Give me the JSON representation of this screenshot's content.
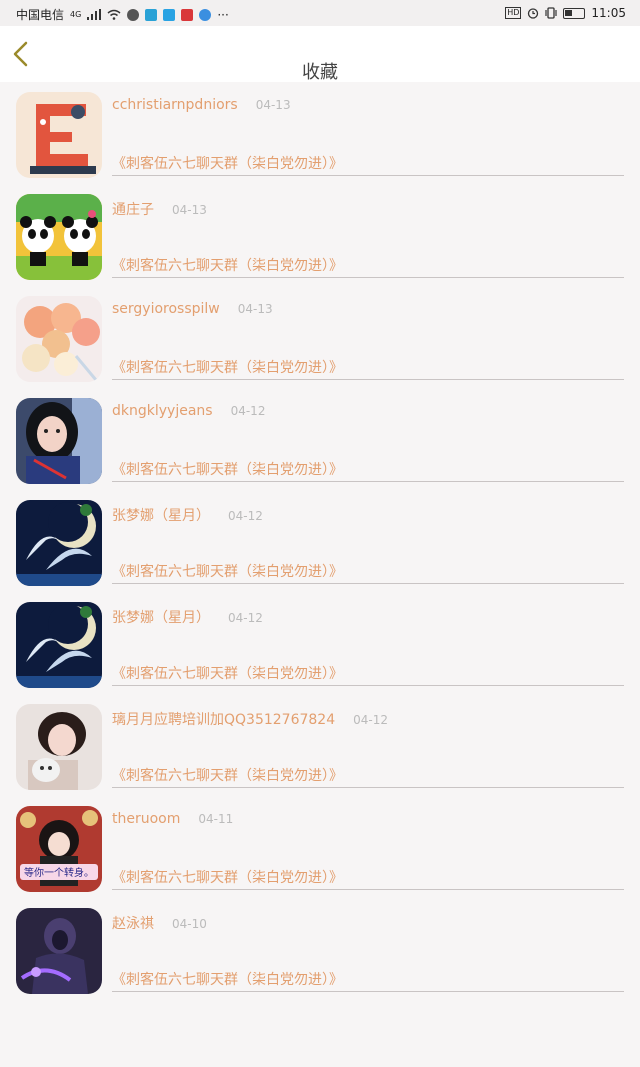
{
  "status_bar": {
    "carrier": "中国电信",
    "network": "4G",
    "time": "11:05"
  },
  "header": {
    "title": "收藏",
    "back_icon": "chevron-left-icon"
  },
  "colors": {
    "accent": "#e39f6f",
    "back": "#9a8a2a",
    "divider": "#c9c4c4"
  },
  "items": [
    {
      "name": "cchristiarnpdniors",
      "date": "04-13",
      "group": "《刺客伍六七聊天群（柒白党勿进）》",
      "avatar": "letter-e-illustration"
    },
    {
      "name": "通庄子",
      "date": "04-13",
      "group": "《刺客伍六七聊天群（柒白党勿进）》",
      "avatar": "pandas"
    },
    {
      "name": "sergyiorosspilw",
      "date": "04-13",
      "group": "《刺客伍六七聊天群（柒白党勿进）》",
      "avatar": "balloons"
    },
    {
      "name": "dkngklyyjeans",
      "date": "04-12",
      "group": "《刺客伍六七聊天群（柒白党勿进）》",
      "avatar": "girl-photo"
    },
    {
      "name": "张梦娜（星月）",
      "date": "04-12",
      "group": "《刺客伍六七聊天群（柒白党勿进）》",
      "avatar": "cranes-moon"
    },
    {
      "name": "张梦娜（星月）",
      "date": "04-12",
      "group": "《刺客伍六七聊天群（柒白党勿进）》",
      "avatar": "cranes-moon"
    },
    {
      "name": "璃月月应聘培训加QQ3512767824",
      "date": "04-12",
      "group": "《刺客伍六七聊天群（柒白党勿进）》",
      "avatar": "girl-cat"
    },
    {
      "name": "theruoom",
      "date": "04-11",
      "group": "《刺客伍六七聊天群（柒白党勿进）》",
      "avatar": "anime-girl",
      "avatar_caption": "等你一个转身。"
    },
    {
      "name": "赵泳祺",
      "date": "04-10",
      "group": "《刺客伍六七聊天群（柒白党勿进）》",
      "avatar": "dark-warrior"
    }
  ]
}
